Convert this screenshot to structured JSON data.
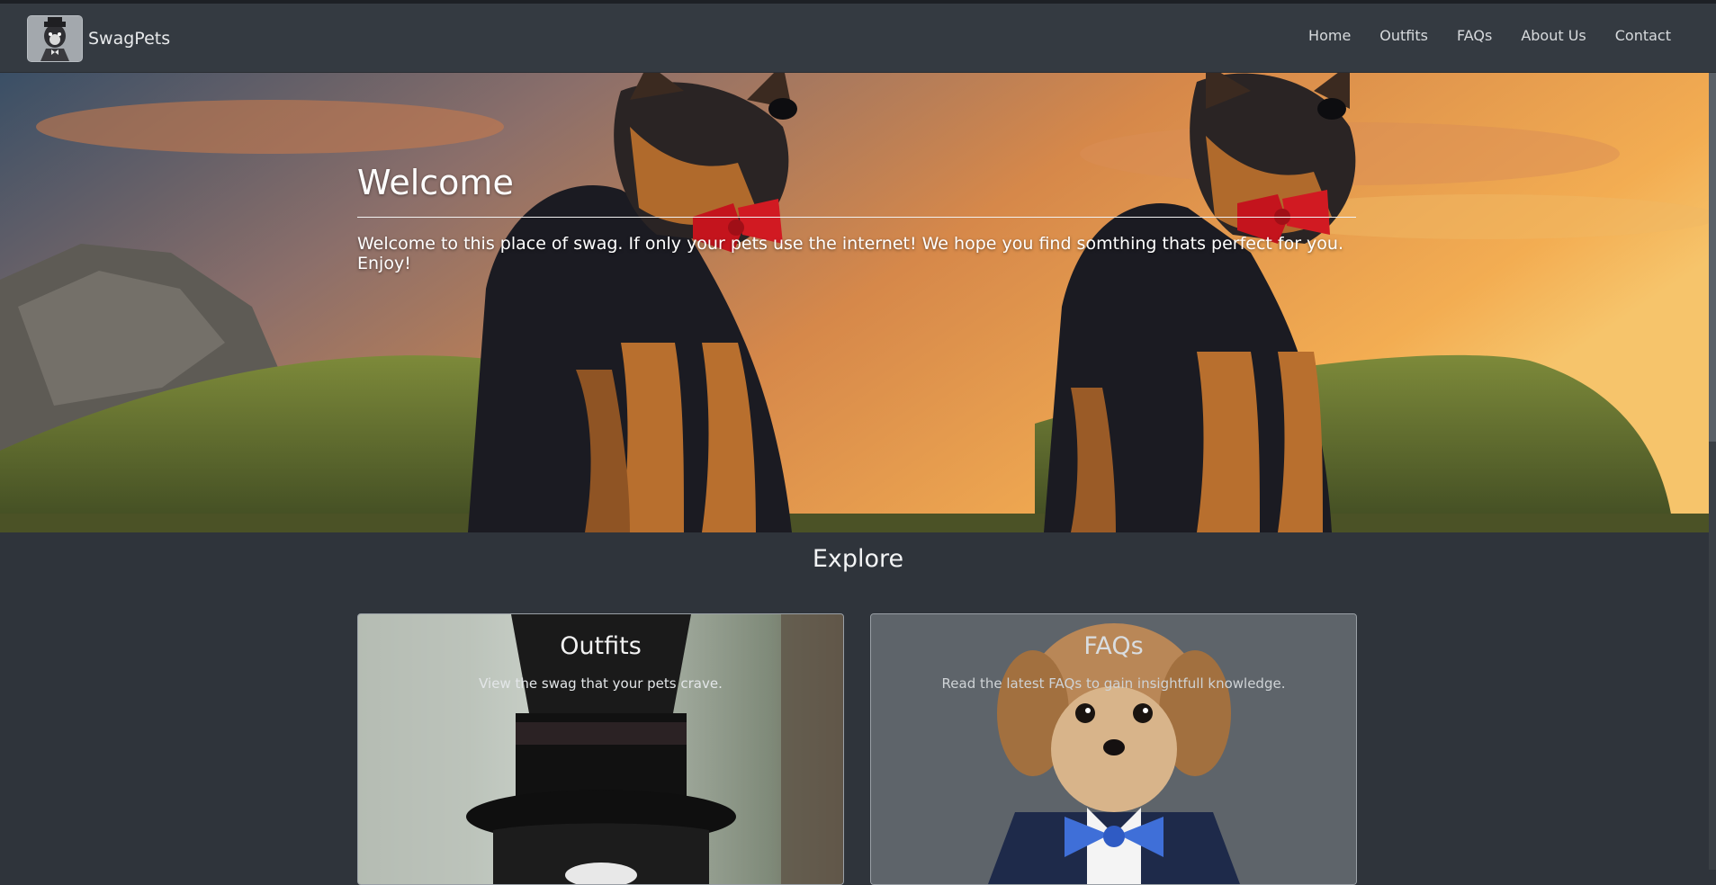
{
  "navbar": {
    "brand_name": "SwagPets",
    "logo_icon": "dog-with-bowtie-logo",
    "links": [
      {
        "label": "Home"
      },
      {
        "label": "Outfits"
      },
      {
        "label": "FAQs"
      },
      {
        "label": "About Us"
      },
      {
        "label": "Contact"
      }
    ]
  },
  "hero": {
    "title": "Welcome",
    "subtitle": "Welcome to this place of swag. If only your pets use the internet! We hope you find somthing thats perfect for you. Enjoy!",
    "image": "two-german-shepherds-with-red-bowties-at-sunset"
  },
  "explore": {
    "title": "Explore",
    "cards": [
      {
        "title": "Outfits",
        "subtitle": "View the swag that your pets crave.",
        "image": "cat-in-top-hat"
      },
      {
        "title": "FAQs",
        "subtitle": "Read the latest FAQs to gain insightfull knowledge.",
        "image": "small-dog-in-tuxedo-with-blue-bowtie"
      }
    ]
  },
  "colors": {
    "page_bg": "#2f343b",
    "navbar_bg": "#343a41",
    "text": "#ffffff"
  }
}
